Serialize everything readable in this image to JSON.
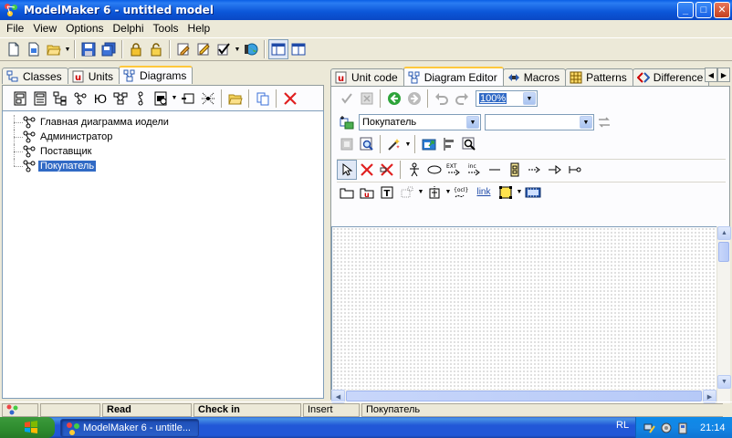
{
  "window": {
    "title": "ModelMaker 6 - untitled model",
    "buttons": {
      "minimize": "_",
      "maximize": "□",
      "close": "✕"
    }
  },
  "menu": [
    "File",
    "View",
    "Options",
    "Delphi",
    "Tools",
    "Help"
  ],
  "left_tabs": [
    {
      "label": "Classes",
      "active": false
    },
    {
      "label": "Units",
      "active": false
    },
    {
      "label": "Diagrams",
      "active": true
    }
  ],
  "tree": {
    "items": [
      {
        "label": "Главная диаграмма иодели",
        "selected": false
      },
      {
        "label": "Администратор",
        "selected": false
      },
      {
        "label": "Поставщик",
        "selected": false
      },
      {
        "label": "Покупатель",
        "selected": true
      }
    ]
  },
  "right_tabs": [
    {
      "label": "Unit code",
      "active": false
    },
    {
      "label": "Diagram Editor",
      "active": true
    },
    {
      "label": "Macros",
      "active": false
    },
    {
      "label": "Patterns",
      "active": false
    },
    {
      "label": "Difference",
      "active": false
    }
  ],
  "editor": {
    "zoom": "100%",
    "diagram_select": "Покупатель",
    "secondary_select": "",
    "tool_labels": {
      "ext": "EXT",
      "inc": "inc",
      "ocl": "{ocl}",
      "link": "link"
    }
  },
  "status": {
    "read": "Read",
    "checkin": "Check in",
    "mode": "Insert",
    "current": "Покупатель"
  },
  "taskbar": {
    "task_label": "ModelMaker 6 - untitle...",
    "language": "RL",
    "clock": "21:14"
  },
  "colors": {
    "title_blue": "#0b56d8",
    "selection": "#316ac5",
    "tab_highlight": "#ffc83c"
  }
}
